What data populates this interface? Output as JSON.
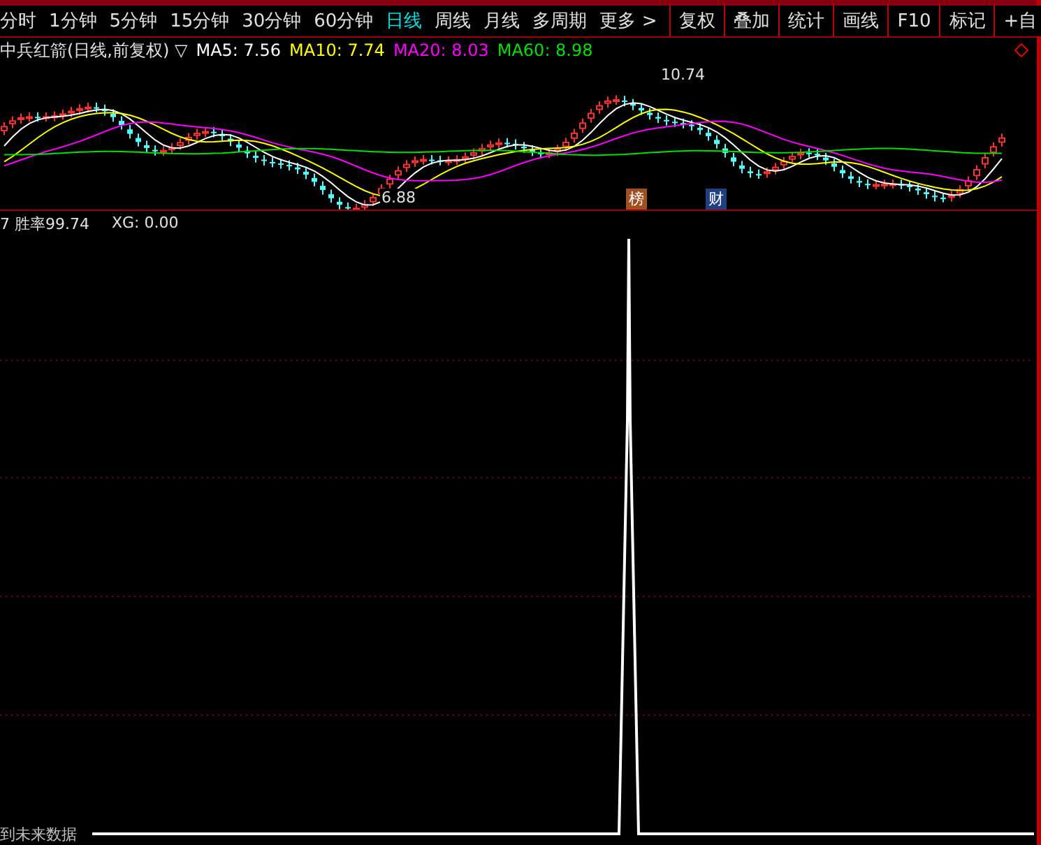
{
  "period_tabs": [
    {
      "label": "分时",
      "selected": false
    },
    {
      "label": "1分钟",
      "selected": false
    },
    {
      "label": "5分钟",
      "selected": false
    },
    {
      "label": "15分钟",
      "selected": false
    },
    {
      "label": "30分钟",
      "selected": false
    },
    {
      "label": "60分钟",
      "selected": false
    },
    {
      "label": "日线",
      "selected": true
    },
    {
      "label": "周线",
      "selected": false
    },
    {
      "label": "月线",
      "selected": false
    },
    {
      "label": "多周期",
      "selected": false
    },
    {
      "label": "更多 >",
      "selected": false
    }
  ],
  "tool_buttons": [
    "复权",
    "叠加",
    "统计",
    "画线",
    "F10",
    "标记",
    "+自"
  ],
  "price_chart": {
    "title": "中兵红箭(日线,前复权) ▽",
    "moving_averages": [
      {
        "label": "MA5: 7.56",
        "color": "#ffffff"
      },
      {
        "label": "MA10: 7.74",
        "color": "#ffff00"
      },
      {
        "label": "MA20: 8.03",
        "color": "#ff00ff"
      },
      {
        "label": "MA60: 8.98",
        "color": "#00e000"
      }
    ],
    "high_label": "10.74",
    "low_label": "6.88",
    "badges": [
      {
        "label": "榜",
        "kind": "list"
      },
      {
        "label": "财",
        "kind": "finance"
      }
    ]
  },
  "indicator": {
    "label": "7 胜率99.74",
    "xg": "XG: 0.00",
    "note": "到未来数据"
  }
}
